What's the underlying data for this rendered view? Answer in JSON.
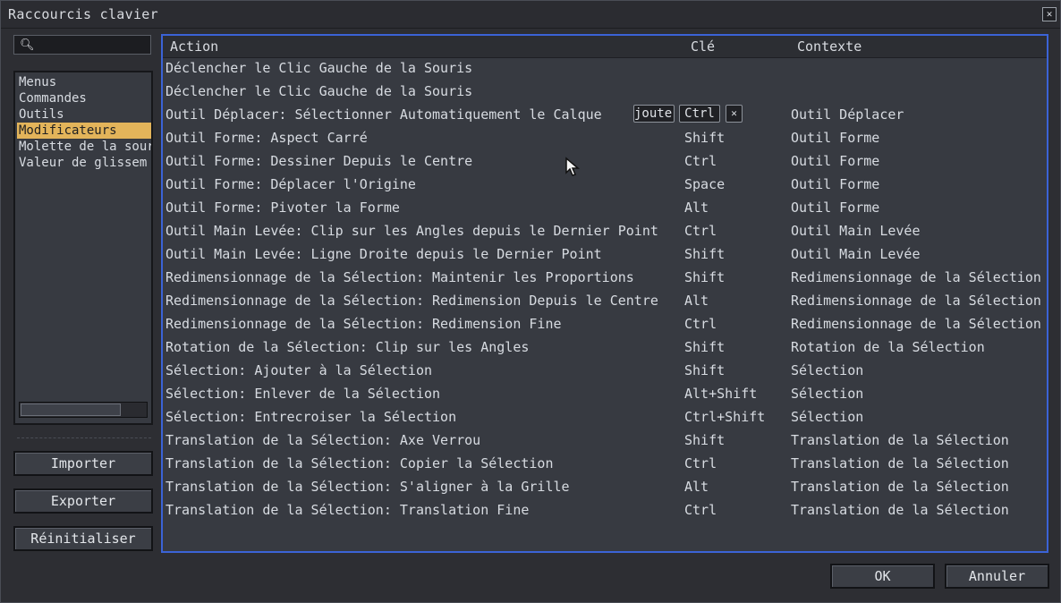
{
  "window": {
    "title": "Raccourcis clavier",
    "close_label": "✕"
  },
  "search": {
    "value": "",
    "placeholder": ""
  },
  "categories": [
    {
      "label": "Menus",
      "selected": false
    },
    {
      "label": "Commandes",
      "selected": false
    },
    {
      "label": "Outils",
      "selected": false
    },
    {
      "label": "Modificateurs",
      "selected": true
    },
    {
      "label": "Molette de la sour",
      "selected": false
    },
    {
      "label": "Valeur de glissem",
      "selected": false
    }
  ],
  "side_buttons": {
    "import": "Importer",
    "export": "Exporter",
    "reset": "Réinitialiser"
  },
  "table": {
    "headers": {
      "action": "Action",
      "key": "Clé",
      "context": "Contexte"
    },
    "rows": [
      {
        "action": "Déclencher le Clic Gauche de la Souris",
        "key": "",
        "context": ""
      },
      {
        "action": "Déclencher le Clic Gauche de la Souris",
        "key": "",
        "context": ""
      },
      {
        "action": "Outil Déplacer: Sélectionner Automatiquement le Calque",
        "key": "",
        "context": "Outil Déplacer",
        "editing": true
      },
      {
        "action": "Outil Forme: Aspect Carré",
        "key": "Shift",
        "context": "Outil Forme"
      },
      {
        "action": "Outil Forme: Dessiner Depuis le Centre",
        "key": "Ctrl",
        "context": "Outil Forme"
      },
      {
        "action": "Outil Forme: Déplacer l'Origine",
        "key": "Space",
        "context": "Outil Forme"
      },
      {
        "action": "Outil Forme: Pivoter la Forme",
        "key": "Alt",
        "context": "Outil Forme"
      },
      {
        "action": "Outil Main Levée: Clip sur les Angles depuis le Dernier Point",
        "key": "Ctrl",
        "context": "Outil Main Levée"
      },
      {
        "action": "Outil Main Levée: Ligne Droite depuis le Dernier Point",
        "key": "Shift",
        "context": "Outil Main Levée"
      },
      {
        "action": "Redimensionnage de la Sélection: Maintenir les Proportions",
        "key": "Shift",
        "context": "Redimensionnage de la Sélection"
      },
      {
        "action": "Redimensionnage de la Sélection: Redimension Depuis le Centre",
        "key": "Alt",
        "context": "Redimensionnage de la Sélection"
      },
      {
        "action": "Redimensionnage de la Sélection: Redimension Fine",
        "key": "Ctrl",
        "context": "Redimensionnage de la Sélection"
      },
      {
        "action": "Rotation de la Sélection: Clip sur les Angles",
        "key": "Shift",
        "context": "Rotation de la Sélection"
      },
      {
        "action": "Sélection: Ajouter à la Sélection",
        "key": "Shift",
        "context": "Sélection"
      },
      {
        "action": "Sélection: Enlever de la Sélection",
        "key": "Alt+Shift",
        "context": "Sélection"
      },
      {
        "action": "Sélection: Entrecroiser la Sélection",
        "key": "Ctrl+Shift",
        "context": "Sélection"
      },
      {
        "action": "Translation de la Sélection: Axe Verrou",
        "key": "Shift",
        "context": "Translation de la Sélection"
      },
      {
        "action": "Translation de la Sélection: Copier la Sélection",
        "key": "Ctrl",
        "context": "Translation de la Sélection"
      },
      {
        "action": "Translation de la Sélection: S'aligner à la Grille",
        "key": "Alt",
        "context": "Translation de la Sélection"
      },
      {
        "action": "Translation de la Sélection: Translation Fine",
        "key": "Ctrl",
        "context": "Translation de la Sélection"
      }
    ],
    "edit_chips": {
      "add": "jouter",
      "key": "Ctrl",
      "remove": "✕"
    }
  },
  "footer": {
    "ok": "OK",
    "cancel": "Annuler"
  },
  "colors": {
    "accent_border": "#3b63d6",
    "selection": "#e3b45a"
  }
}
